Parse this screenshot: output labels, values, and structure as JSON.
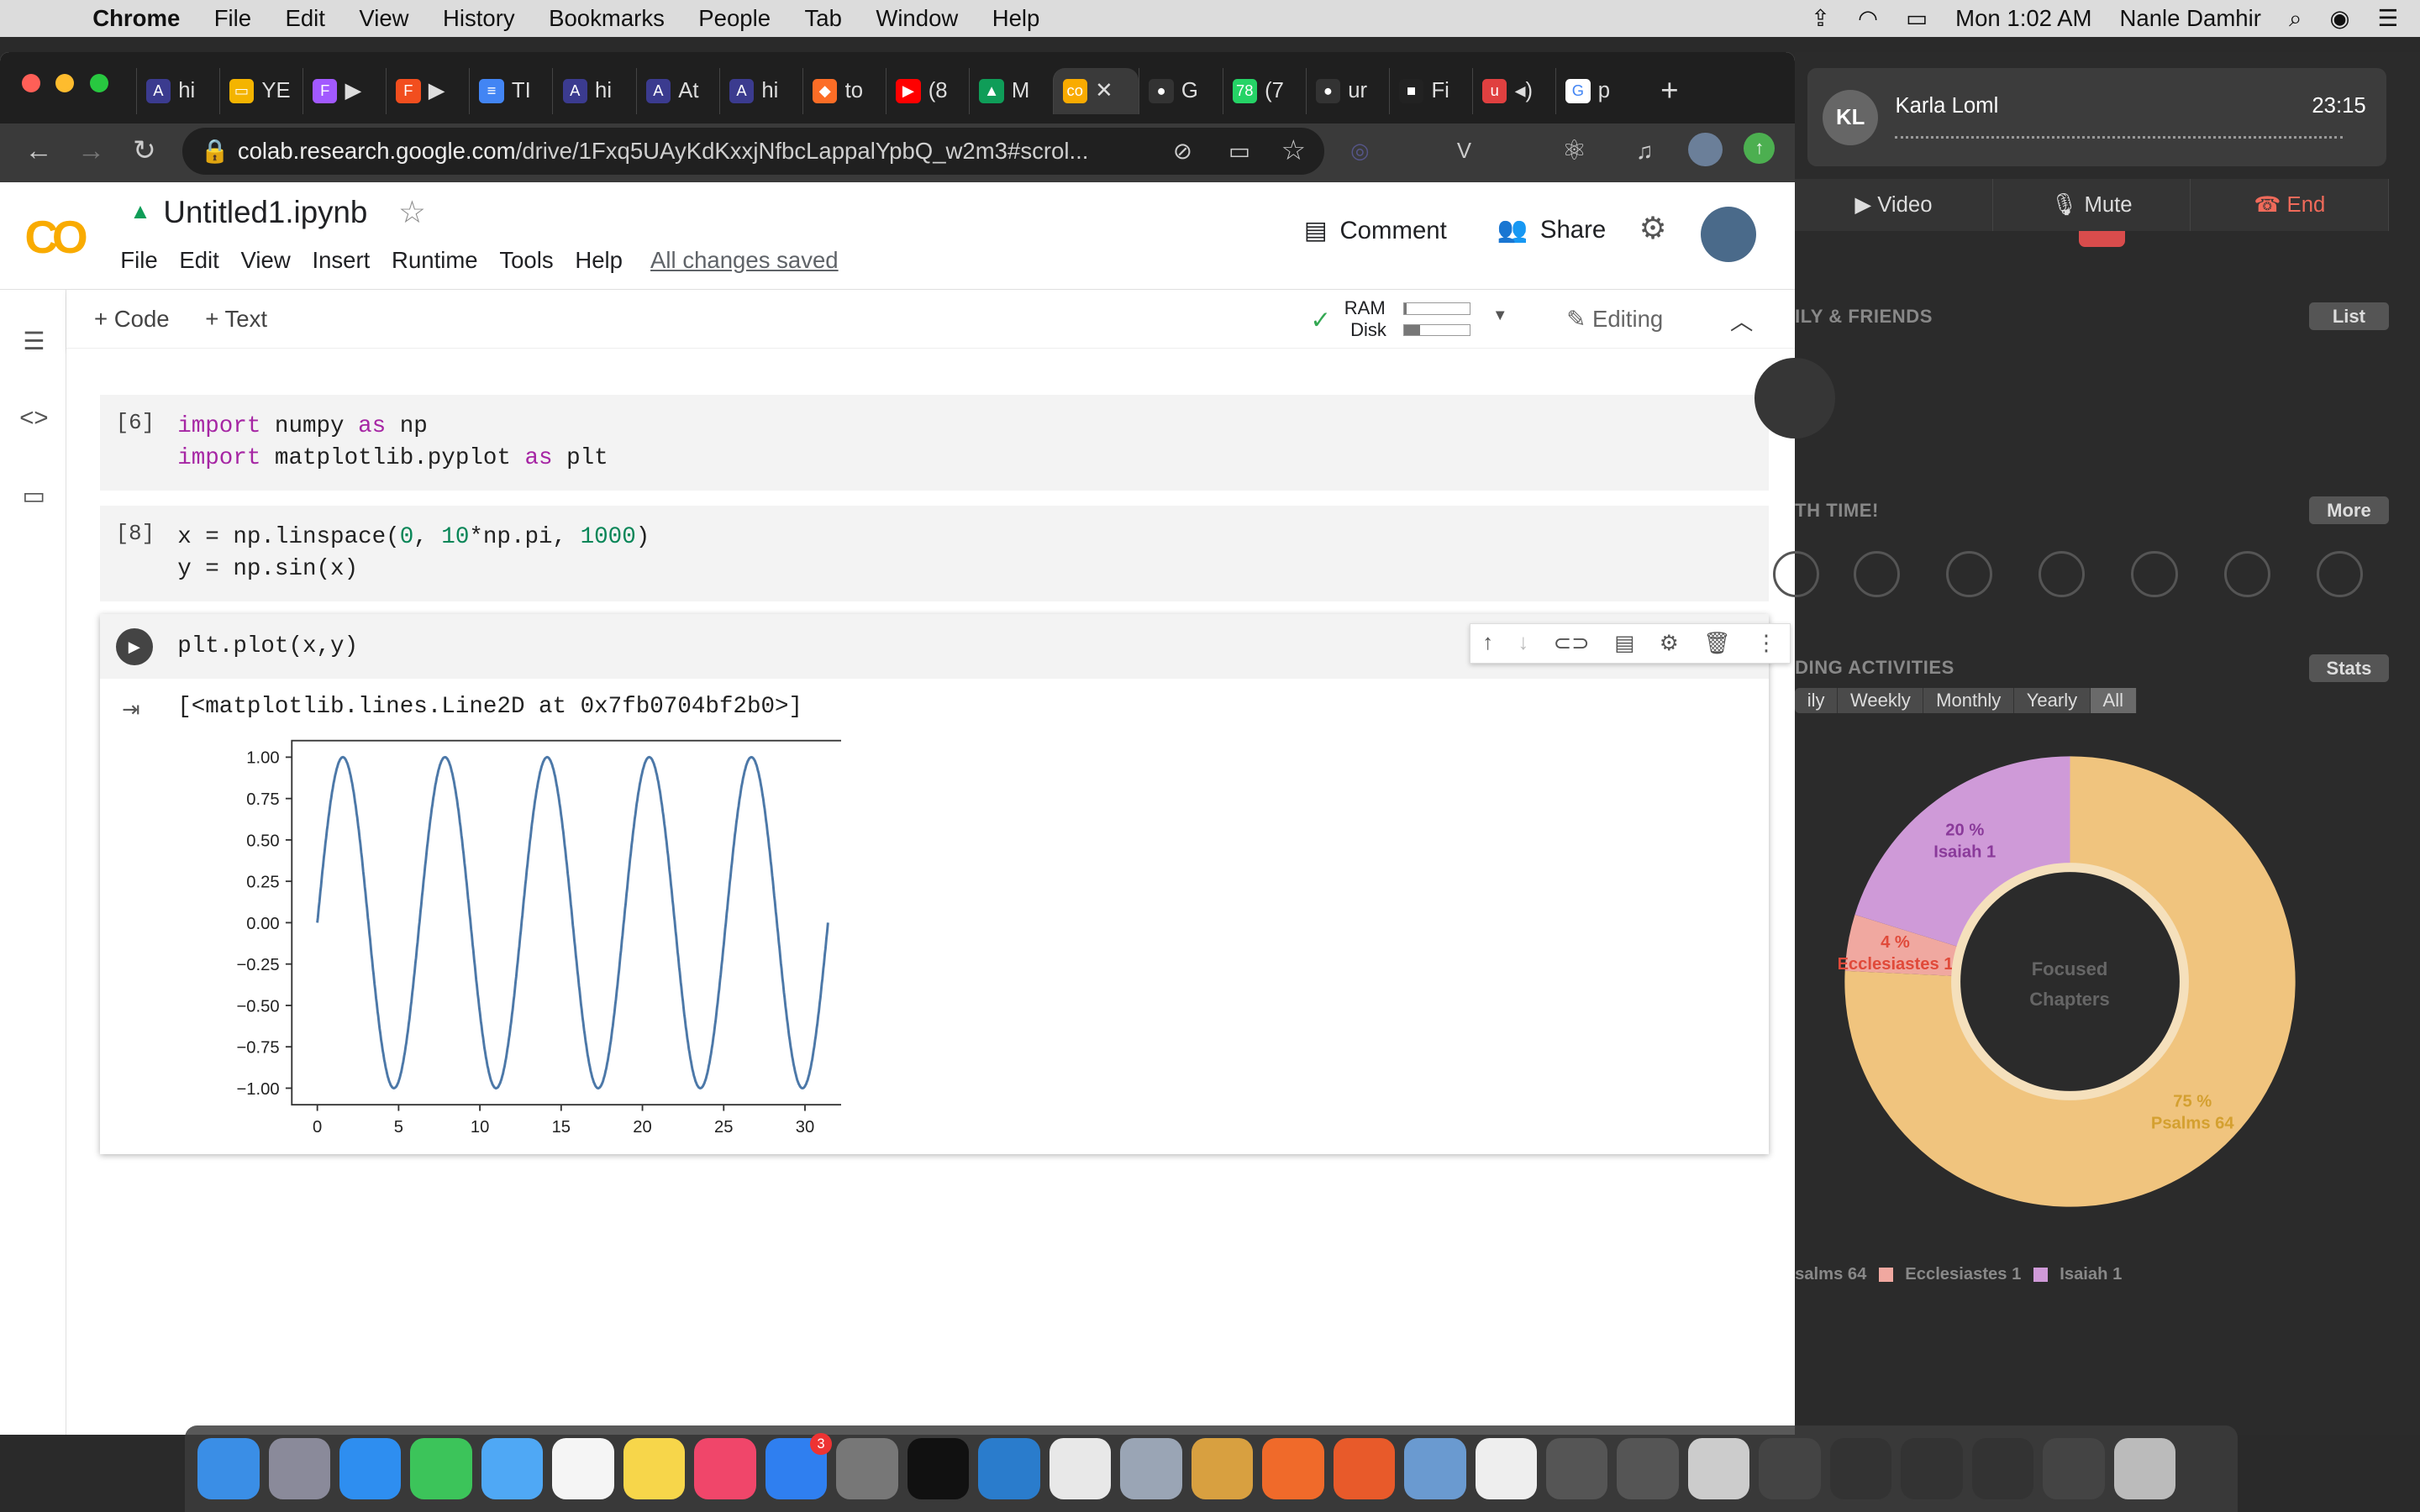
{
  "menubar": {
    "app": "Chrome",
    "items": [
      "File",
      "Edit",
      "View",
      "History",
      "Bookmarks",
      "People",
      "Tab",
      "Window",
      "Help"
    ],
    "clock": "Mon 1:02 AM",
    "user": "Nanle Damhir"
  },
  "browser": {
    "tabs": [
      {
        "favicon": "A",
        "label": "hi",
        "color": "#3b3b8f"
      },
      {
        "favicon": "▭",
        "label": "YE",
        "color": "#f4b400"
      },
      {
        "favicon": "F",
        "label": "▶",
        "color": "#a259ff"
      },
      {
        "favicon": "F",
        "label": "▶",
        "color": "#f24e1e"
      },
      {
        "favicon": "≡",
        "label": "TI",
        "color": "#4285f4"
      },
      {
        "favicon": "A",
        "label": "hi",
        "color": "#3b3b8f"
      },
      {
        "favicon": "A",
        "label": "At",
        "color": "#3b3b8f"
      },
      {
        "favicon": "A",
        "label": "hi",
        "color": "#3b3b8f"
      },
      {
        "favicon": "◆",
        "label": "to",
        "color": "#fc6d26"
      },
      {
        "favicon": "▶",
        "label": "(8",
        "color": "#ff0000"
      },
      {
        "favicon": "▲",
        "label": "M",
        "color": "#0f9d58"
      },
      {
        "favicon": "co",
        "label": "✕",
        "color": "#f9ab00",
        "active": true
      },
      {
        "favicon": "●",
        "label": "G",
        "color": "#333333"
      },
      {
        "favicon": "78",
        "label": "(7",
        "color": "#25d366"
      },
      {
        "favicon": "●",
        "label": "ur",
        "color": "#333333"
      },
      {
        "favicon": "■",
        "label": "Fi",
        "color": "#222222"
      },
      {
        "favicon": "u",
        "label": "◂)",
        "color": "#e04040"
      },
      {
        "favicon": "G",
        "label": "p",
        "color": "#ffffff"
      }
    ],
    "url_host": "colab.research.google.com",
    "url_path": "/drive/1Fxq5UAyKdKxxjNfbcLappalYpbQ_w2m3#scrol..."
  },
  "colab": {
    "logo": "CO",
    "title": "Untitled1.ipynb",
    "menus": [
      "File",
      "Edit",
      "View",
      "Insert",
      "Runtime",
      "Tools",
      "Help"
    ],
    "saved_status": "All changes saved",
    "comment_label": "Comment",
    "share_label": "Share",
    "add_code": "+ Code",
    "add_text": "+ Text",
    "ram_label": "RAM",
    "disk_label": "Disk",
    "ram_fraction": 0.05,
    "disk_fraction": 0.25,
    "editing_label": "Editing",
    "cells": [
      {
        "num": "[6]",
        "lines": [
          [
            "import",
            " numpy ",
            "as",
            " np"
          ],
          [
            "import",
            " matplotlib.pyplot ",
            "as",
            " plt"
          ]
        ]
      },
      {
        "num": "[8]",
        "line1": "x = np.linspace(",
        "n0": "0",
        "sep": ", ",
        "n10": "10",
        "mid": "*np.pi, ",
        "n1000": "1000",
        "end": ")",
        "line2": "y = np.sin(x)"
      },
      {
        "num": "",
        "code": "plt.plot(x,y)",
        "output_text": "[<matplotlib.lines.Line2D at 0x7fb0704bf2b0>]"
      }
    ]
  },
  "chart_data": {
    "type": "line",
    "series": [
      {
        "function": "sin(x)",
        "x_range": [
          0,
          31.416
        ],
        "points": 1000
      }
    ],
    "xticks": [
      "0",
      "5",
      "10",
      "15",
      "20",
      "25",
      "30"
    ],
    "yticks": [
      "1.00",
      "0.75",
      "0.50",
      "0.25",
      "0.00",
      "−0.25",
      "−0.50",
      "−0.75",
      "−1.00"
    ],
    "xlim": [
      -1.57,
      32.99
    ],
    "ylim": [
      -1.1,
      1.1
    ],
    "line_color": "#4c78a8",
    "grid": false
  },
  "rightapp": {
    "caller_initials": "KL",
    "caller_name": "Karla Loml",
    "call_time": "23:15",
    "video_label": "Video",
    "mute_label": "Mute",
    "end_label": "End",
    "section1": "ILY & FRIENDS",
    "list_label": "List",
    "section2": "TH TIME!",
    "more_label": "More",
    "section3": "DING ACTIVITIES",
    "stats_label": "Stats",
    "ranges": [
      "ily",
      "Weekly",
      "Monthly",
      "Yearly",
      "All"
    ],
    "donut_center_1": "Focused",
    "donut_center_2": "Chapters",
    "slices": [
      {
        "pct": "75 %",
        "name": "Psalms 64",
        "value": 75,
        "color": "#f0c47e",
        "label_color": "#d4a030"
      },
      {
        "pct": "4 %",
        "name": "Ecclesiastes 1",
        "value": 4,
        "color": "#f0a8a0",
        "label_color": "#e04a3a"
      },
      {
        "pct": "20 %",
        "name": "Isaiah 1",
        "value": 20,
        "color": "#cf9ad8",
        "label_color": "#8a3a9a"
      }
    ],
    "legend": [
      "salms 64",
      "Ecclesiastes 1",
      "Isaiah 1"
    ]
  }
}
